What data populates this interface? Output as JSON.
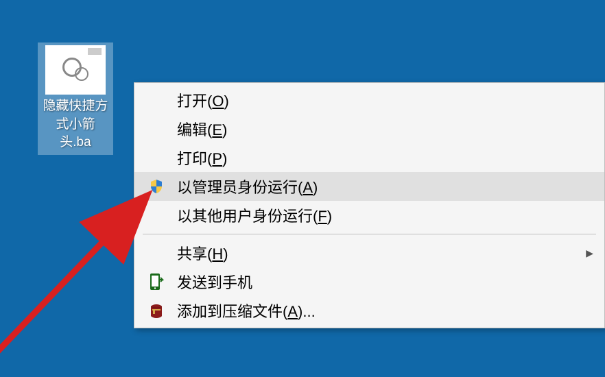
{
  "desktop": {
    "icon_label": "隐藏快捷方式小箭头.ba"
  },
  "context_menu": {
    "items": [
      {
        "label": "打开",
        "hotkey": "O",
        "icon": null,
        "hovered": false,
        "submenu": false
      },
      {
        "label": "编辑",
        "hotkey": "E",
        "icon": null,
        "hovered": false,
        "submenu": false
      },
      {
        "label": "打印",
        "hotkey": "P",
        "icon": null,
        "hovered": false,
        "submenu": false
      },
      {
        "label": "以管理员身份运行",
        "hotkey": "A",
        "icon": "shield",
        "hovered": true,
        "submenu": false
      },
      {
        "label": "以其他用户身份运行",
        "hotkey": "F",
        "icon": null,
        "hovered": false,
        "submenu": false
      },
      {
        "separator": true
      },
      {
        "label": "共享",
        "hotkey": "H",
        "icon": null,
        "hovered": false,
        "submenu": true
      },
      {
        "label": "发送到手机",
        "hotkey": null,
        "icon": "phone",
        "hovered": false,
        "submenu": false
      },
      {
        "label": "添加到压缩文件",
        "hotkey": "A",
        "suffix": "...",
        "icon": "archive",
        "hovered": false,
        "submenu": false
      }
    ]
  }
}
